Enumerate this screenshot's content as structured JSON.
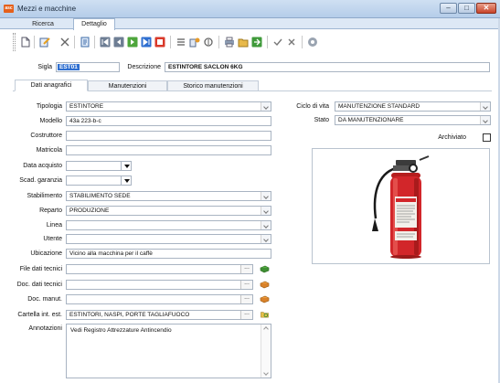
{
  "window": {
    "title": "Mezzi e macchine",
    "app_icon": "app-logo-icon",
    "controls": [
      "minimize-icon",
      "maximize-icon",
      "close-icon"
    ]
  },
  "top_tabs": [
    {
      "label": "Ricerca"
    },
    {
      "label": "Dettaglio",
      "active": true
    }
  ],
  "toolbar": {
    "icons": [
      "new-icon",
      "save-edit-icon",
      "delete-icon",
      "document-icon",
      "first-icon",
      "prev-icon",
      "next-icon",
      "last-icon",
      "cancel-red-icon",
      "list-icon",
      "report-icon",
      "attach-icon",
      "print-icon",
      "folder-icon",
      "export-icon",
      "confirm-icon",
      "undo-icon",
      "help-icon"
    ]
  },
  "header": {
    "sigla_label": "Sigla",
    "sigla_value": "EST01",
    "descrizione_label": "Descrizione",
    "descrizione_value": "ESTINTORE SACLON 6KG"
  },
  "sub_tabs": [
    {
      "label": "Dati anagrafici",
      "active": true
    },
    {
      "label": "Manutenzioni"
    },
    {
      "label": "Storico manutenzioni"
    }
  ],
  "form": {
    "tipologia": {
      "label": "Tipologia",
      "value": "ESTINTORE"
    },
    "modello": {
      "label": "Modello",
      "value": "43a 223-b-c"
    },
    "costruttore": {
      "label": "Costruttore",
      "value": ""
    },
    "matricola": {
      "label": "Matricola",
      "value": ""
    },
    "data_acquisto": {
      "label": "Data acquisto",
      "value": ""
    },
    "scad_garanzia": {
      "label": "Scad. garanzia",
      "value": ""
    },
    "stabilimento": {
      "label": "Stabilimento",
      "value": "STABILIMENTO SEDE"
    },
    "reparto": {
      "label": "Reparto",
      "value": "PRODUZIONE"
    },
    "linea": {
      "label": "Linea",
      "value": ""
    },
    "utente": {
      "label": "Utente",
      "value": ""
    },
    "ubicazione": {
      "label": "Ubicazione",
      "value": "Vicino alla macchina per il caffè"
    },
    "file_dati_tecnici": {
      "label": "File dati tecnici",
      "value": ""
    },
    "doc_dati_tecnici": {
      "label": "Doc. dati tecnici",
      "value": ""
    },
    "doc_manut": {
      "label": "Doc. manut.",
      "value": ""
    },
    "cartella_int_est": {
      "label": "Cartella int. est.",
      "value": "ESTINTORI, NASPI, PORTE TAGLIAFUOCO"
    },
    "annotazioni": {
      "label": "Annotazioni",
      "value": "Vedi Registro Attrezzature Antincendio"
    },
    "ciclo_di_vita": {
      "label": "Ciclo di vita",
      "value": "MANUTENZIONE STANDARD"
    },
    "stato": {
      "label": "Stato",
      "value": "DA MANUTENZIONARE"
    },
    "archiviato": {
      "label": "Archiviato",
      "checked": false
    }
  },
  "image": {
    "subject": "fire-extinguisher-photo"
  },
  "colors": {
    "title_bar": "#c7dbef",
    "accent_orange": "#e5601b",
    "close_red": "#c8432a",
    "selection_blue": "#2f6fd0"
  }
}
